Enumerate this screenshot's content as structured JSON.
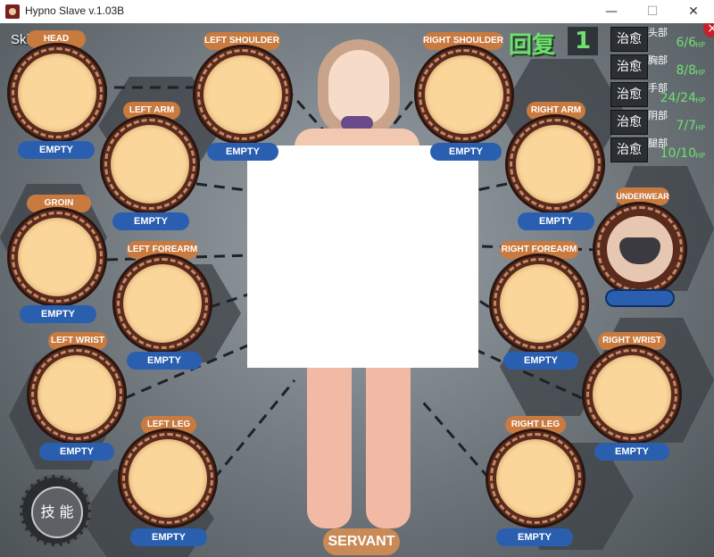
{
  "window": {
    "title": "Hypno Slave v.1.03B",
    "minimize": "—",
    "maximize": "☐",
    "close": "✕"
  },
  "hud": {
    "skip_mode": "Skip Mode",
    "recover_label": "回复",
    "recover_count": "1",
    "hp_unit": "HP",
    "hp_rows": [
      {
        "heal": "治愈",
        "part": "头部",
        "value": "6/6"
      },
      {
        "heal": "治愈",
        "part": "胸部",
        "value": "8/8"
      },
      {
        "heal": "治愈",
        "part": "手部",
        "value": "24/24"
      },
      {
        "heal": "治愈",
        "part": "阴部",
        "value": "7/7"
      },
      {
        "heal": "治愈",
        "part": "腿部",
        "value": "10/10"
      }
    ]
  },
  "slots": {
    "head": {
      "label": "HEAD",
      "status": "EMPTY"
    },
    "left_shoulder": {
      "label": "LEFT SHOULDER",
      "status": "EMPTY"
    },
    "right_shoulder": {
      "label": "RIGHT SHOULDER",
      "status": "EMPTY"
    },
    "left_arm": {
      "label": "LEFT ARM",
      "status": "EMPTY"
    },
    "right_arm": {
      "label": "RIGHT ARM",
      "status": "EMPTY"
    },
    "groin": {
      "label": "GROIN",
      "status": "EMPTY"
    },
    "underwear": {
      "label": "UNDERWEAR",
      "status": ""
    },
    "left_forearm": {
      "label": "LEFT FOREARM",
      "status": "EMPTY"
    },
    "right_forearm": {
      "label": "RIGHT FOREARM",
      "status": "EMPTY"
    },
    "left_wrist": {
      "label": "LEFT WRIST",
      "status": "EMPTY"
    },
    "right_wrist": {
      "label": "RIGHT WRIST",
      "status": "EMPTY"
    },
    "left_leg": {
      "label": "LEFT LEG",
      "status": "EMPTY"
    },
    "right_leg": {
      "label": "RIGHT LEG",
      "status": "EMPTY"
    }
  },
  "servant_label": "SERVANT",
  "skill_label": "技 能",
  "colors": {
    "slot_fill": "#fbd69b",
    "label_orange": "#c97a3f",
    "label_blue": "#2a5fb0",
    "hp_green": "#6fe06f"
  }
}
